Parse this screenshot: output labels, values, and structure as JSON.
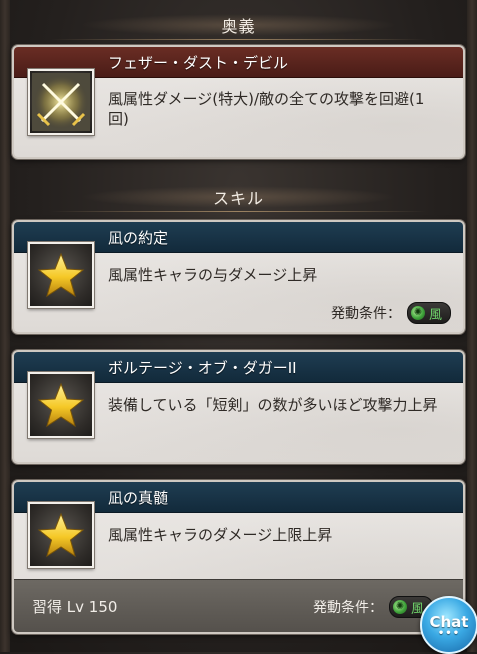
{
  "ougi_section": {
    "header": "奥義"
  },
  "ougi": {
    "name": "フェザー・ダスト・デビル",
    "description": "風属性ダメージ(特大)/敵の全ての攻撃を回避(1回)",
    "icon": "crossed-swords-icon"
  },
  "skills_section": {
    "header": "スキル"
  },
  "skills": [
    {
      "name": "凪の約定",
      "description": "風属性キャラの与ダメージ上昇",
      "icon": "star-icon",
      "condition_label": "発動条件：",
      "condition_element": "風"
    },
    {
      "name": "ボルテージ・オブ・ダガーII",
      "description": "装備している「短剣」の数が多いほど攻撃力上昇",
      "icon": "star-icon"
    },
    {
      "name": "凪の真髄",
      "description": "風属性キャラのダメージ上限上昇",
      "icon": "star-icon",
      "learn_level": "習得 Lv 150",
      "condition_label": "発動条件：",
      "condition_element": "風"
    }
  ],
  "chat_button": {
    "label": "Chat",
    "dots": "•••"
  },
  "colors": {
    "ougi_title_bar": "#5a241d",
    "skill_title_bar": "#1a3548",
    "wind_green": "#6fd36a",
    "star_gold": "#f5c826"
  }
}
